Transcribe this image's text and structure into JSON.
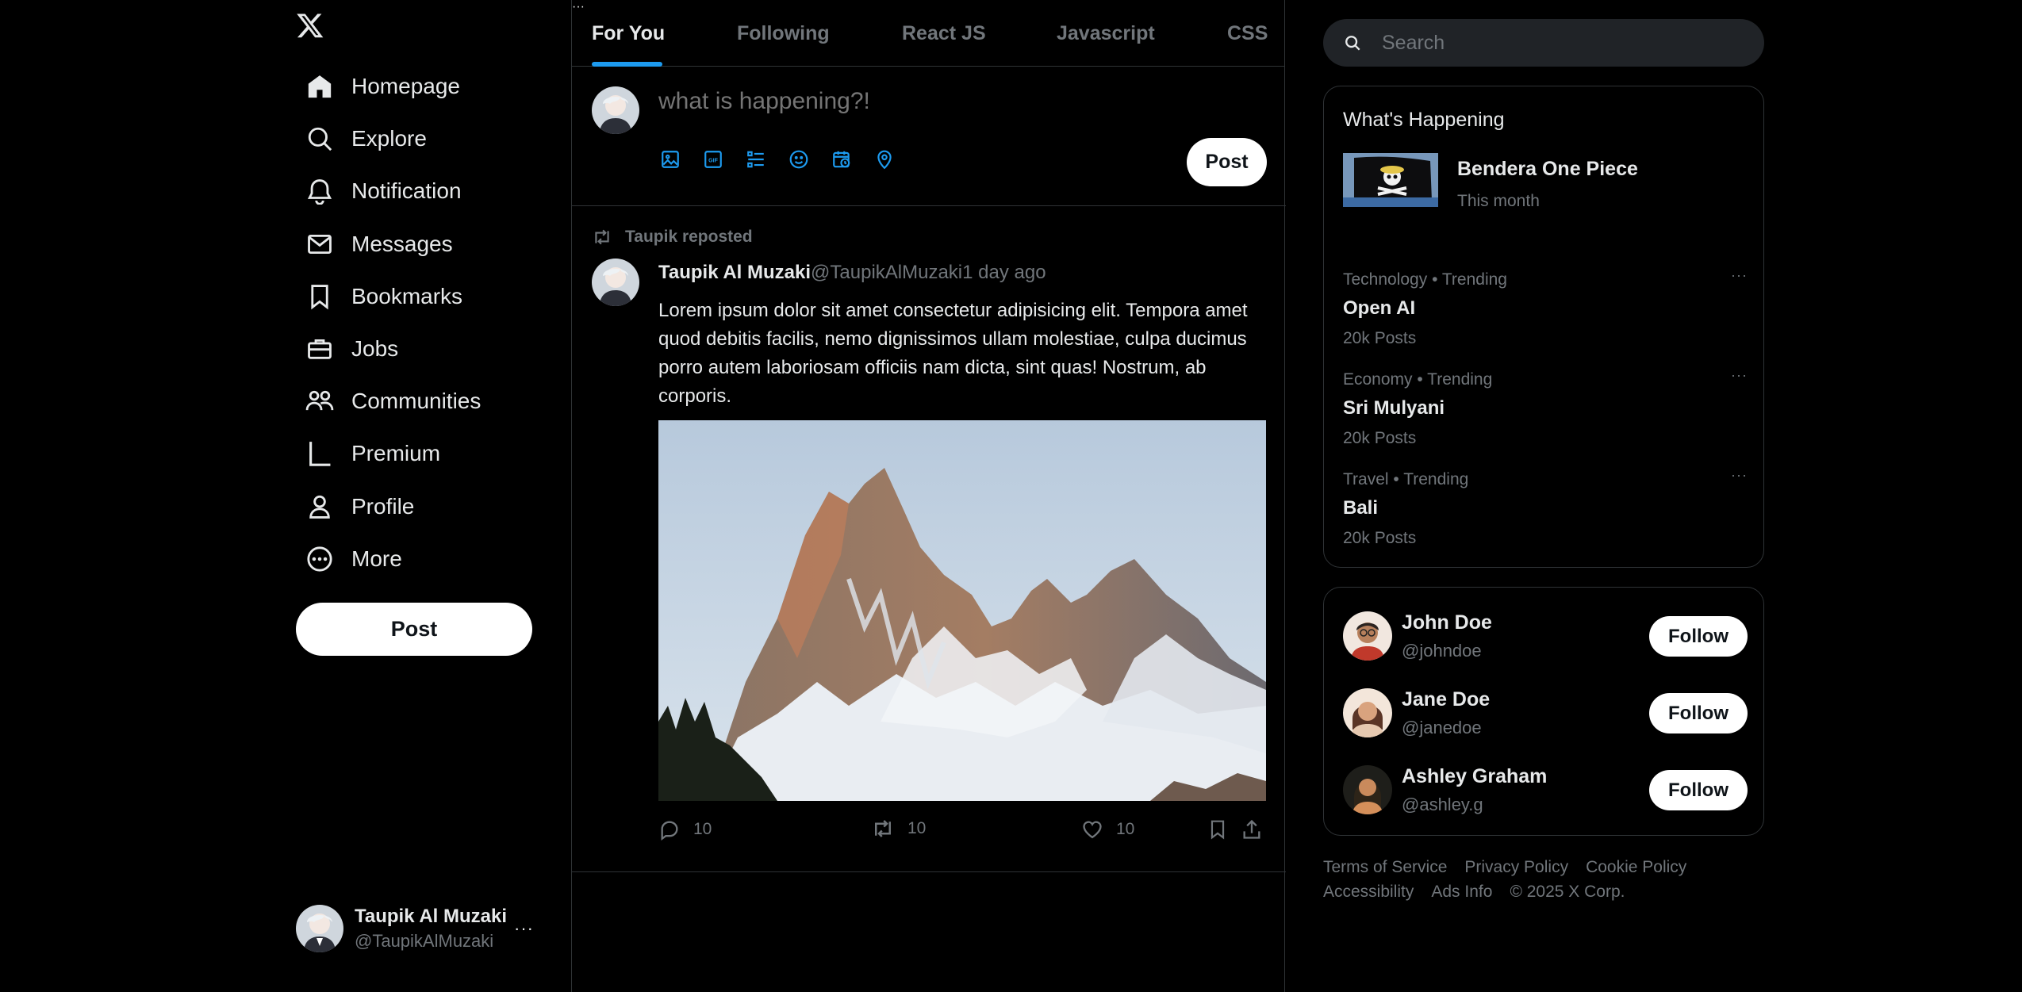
{
  "sidebar": {
    "logo_icon": "x-logo-icon",
    "items": [
      {
        "label": "Homepage",
        "icon": "home-icon"
      },
      {
        "label": "Explore",
        "icon": "search-icon"
      },
      {
        "label": "Notification",
        "icon": "bell-icon"
      },
      {
        "label": "Messages",
        "icon": "mail-icon"
      },
      {
        "label": "Bookmarks",
        "icon": "bookmark-icon"
      },
      {
        "label": "Jobs",
        "icon": "briefcase-icon"
      },
      {
        "label": "Communities",
        "icon": "people-icon"
      },
      {
        "label": "Premium",
        "icon": "x-premium-icon"
      },
      {
        "label": "Profile",
        "icon": "person-icon"
      },
      {
        "label": "More",
        "icon": "more-circle-icon"
      }
    ],
    "post_label": "Post",
    "account": {
      "name": "Taupik Al Muzaki",
      "handle": "@TaupikAlMuzaki",
      "menu": "···"
    }
  },
  "tabs": [
    {
      "label": "For You",
      "active": true
    },
    {
      "label": "Following"
    },
    {
      "label": "React JS"
    },
    {
      "label": "Javascript"
    },
    {
      "label": "CSS"
    }
  ],
  "composer": {
    "placeholder": "what is happening?!",
    "post_label": "Post",
    "tools": [
      "image-icon",
      "gif-icon",
      "poll-icon",
      "emoji-icon",
      "schedule-icon",
      "location-icon"
    ]
  },
  "tweet": {
    "repost_text": "Taupik reposted",
    "name": "Taupik Al Muzaki",
    "handle": "@TaupikAlMuzaki",
    "time": "1 day ago",
    "more": "···",
    "text": "Lorem ipsum dolor sit amet consectetur adipisicing elit. Tempora amet quod debitis facilis, nemo dignissimos ullam molestiae, culpa ducimus porro autem laboriosam officiis nam dicta, sint quas! Nostrum, ab corporis.",
    "replies": "10",
    "reposts": "10",
    "likes": "10"
  },
  "search": {
    "placeholder": "Search"
  },
  "happening": {
    "title": "What's Happening",
    "featured": {
      "title": "Bendera One Piece",
      "subtitle": "This month"
    },
    "trends": [
      {
        "meta": "Technology • Trending",
        "title": "Open AI",
        "count": "20k Posts"
      },
      {
        "meta": "Economy • Trending",
        "title": "Sri Mulyani",
        "count": "20k Posts"
      },
      {
        "meta": "Travel • Trending",
        "title": "Bali",
        "count": "20k Posts"
      }
    ],
    "dots": "···"
  },
  "who": {
    "follow_label": "Follow",
    "users": [
      {
        "name": "John Doe",
        "handle": "@johndoe"
      },
      {
        "name": "Jane Doe",
        "handle": "@janedoe"
      },
      {
        "name": "Ashley Graham",
        "handle": "@ashley.g"
      }
    ]
  },
  "footer": {
    "links": [
      "Terms of Service",
      "Privacy Policy",
      "Cookie Policy",
      "Accessibility",
      "Ads Info"
    ],
    "copyright": "© 2025 X Corp."
  },
  "colors": {
    "accent": "#1d9bf0",
    "background": "#000000",
    "muted": "#71767b",
    "border": "#2f3336"
  }
}
